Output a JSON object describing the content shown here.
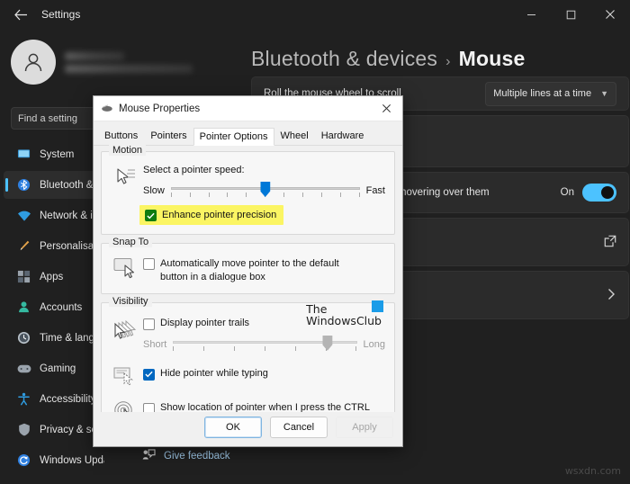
{
  "window": {
    "title": "Settings",
    "back_icon": "back-arrow-icon",
    "minimize_icon": "minimize-icon",
    "maximize_icon": "maximize-icon",
    "close_icon": "close-icon"
  },
  "account": {
    "avatar_icon": "person-avatar-icon"
  },
  "search": {
    "placeholder": "Find a setting",
    "value": "Find a setting",
    "icon": "search-icon"
  },
  "sidebar": {
    "items": [
      {
        "label": "System",
        "icon": "system-icon",
        "selected": false
      },
      {
        "label": "Bluetooth & devices",
        "icon": "bluetooth-icon",
        "selected": true
      },
      {
        "label": "Network & internet",
        "icon": "network-icon",
        "selected": false
      },
      {
        "label": "Personalisation",
        "icon": "personalisation-icon",
        "selected": false
      },
      {
        "label": "Apps",
        "icon": "apps-icon",
        "selected": false
      },
      {
        "label": "Accounts",
        "icon": "accounts-icon",
        "selected": false
      },
      {
        "label": "Time & language",
        "icon": "time-language-icon",
        "selected": false
      },
      {
        "label": "Gaming",
        "icon": "gaming-icon",
        "selected": false
      },
      {
        "label": "Accessibility",
        "icon": "accessibility-icon",
        "selected": false
      },
      {
        "label": "Privacy & security",
        "icon": "privacy-security-icon",
        "selected": false
      },
      {
        "label": "Windows Update",
        "icon": "windows-update-icon",
        "selected": false
      }
    ]
  },
  "breadcrumb": {
    "parent": "Bluetooth & devices",
    "separator": "›",
    "current": "Mouse"
  },
  "content": {
    "scroll_row": {
      "label": "Roll the mouse wheel to scroll",
      "dropdown_value": "Multiple lines at a time",
      "chevron": "chevron-down-icon"
    },
    "hover_row": {
      "label": "Scroll inactive windows when hovering over them",
      "toggle_state": "On"
    },
    "link_row": {
      "external_icon": "open-external-icon"
    },
    "more_row": {
      "chevron": "chevron-right-icon"
    },
    "feedback": {
      "label": "Give feedback",
      "icon": "feedback-icon"
    }
  },
  "watermarks": {
    "site": "wsxdn.com",
    "blog_line1": "The",
    "blog_line2": "WindowsClub",
    "blog_logo": "windowsclub-logo-icon"
  },
  "dialog": {
    "title": "Mouse Properties",
    "title_icon": "mouse-icon",
    "close_icon": "close-icon",
    "tabs": [
      {
        "label": "Buttons",
        "active": false
      },
      {
        "label": "Pointers",
        "active": false
      },
      {
        "label": "Pointer Options",
        "active": true
      },
      {
        "label": "Wheel",
        "active": false
      },
      {
        "label": "Hardware",
        "active": false
      }
    ],
    "motion": {
      "group_title": "Motion",
      "speed_label": "Select a pointer speed:",
      "slow_label": "Slow",
      "fast_label": "Fast",
      "slider_percent": 50,
      "enhance_precision": {
        "label": "Enhance pointer precision",
        "checked": true,
        "highlighted": true
      }
    },
    "snap_to": {
      "group_title": "Snap To",
      "auto_move": {
        "label": "Automatically move pointer to the default button in a dialogue box",
        "checked": false
      }
    },
    "visibility": {
      "group_title": "Visibility",
      "pointer_trails": {
        "label": "Display pointer trails",
        "checked": false
      },
      "trails_short_label": "Short",
      "trails_long_label": "Long",
      "trails_slider_percent": 84,
      "hide_typing": {
        "label": "Hide pointer while typing",
        "checked": true
      },
      "show_ctrl": {
        "label": "Show location of pointer when I press the CTRL key",
        "checked": false
      }
    },
    "buttons": {
      "ok": "OK",
      "cancel": "Cancel",
      "apply": "Apply",
      "apply_disabled": true
    }
  },
  "colors": {
    "accent": "#4cc2ff",
    "highlight": "#fbf563",
    "check_green": "#107c10",
    "check_blue": "#0067c0",
    "slider_blue": "#0078d7"
  }
}
